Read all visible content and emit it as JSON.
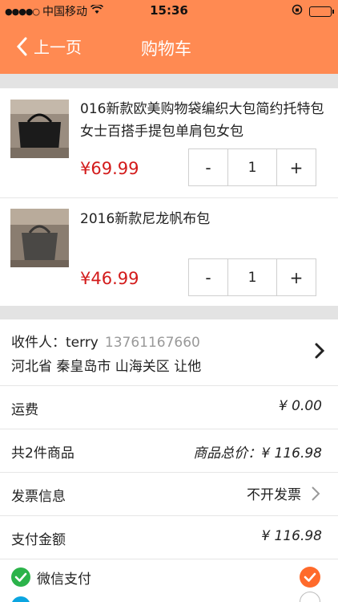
{
  "status": {
    "carrier": "中国移动",
    "time": "15:36"
  },
  "nav": {
    "back_label": "上一页",
    "title": "购物车"
  },
  "items": [
    {
      "title": "016新款欧美购物袋编织大包简约托特包女士百搭手提包单肩包女包",
      "price": "¥69.99",
      "qty": "1"
    },
    {
      "title": "2016新款尼龙帆布包",
      "price": "¥46.99",
      "qty": "1"
    }
  ],
  "stepper": {
    "minus": "-",
    "plus": "+"
  },
  "address": {
    "recipient_label": "收件人：terry",
    "phone": "13761167660",
    "detail": "河北省 秦皇岛市 山海关区 让他"
  },
  "summary": {
    "shipping_label": "运费",
    "shipping_value": "¥ 0.00",
    "count_label": "共2件商品",
    "total_label": "商品总价：¥ 116.98",
    "invoice_label": "发票信息",
    "invoice_value": "不开发票",
    "pay_amount_label": "支付金额",
    "pay_amount_value": "¥ 116.98"
  },
  "payment": {
    "options": [
      {
        "label": "微信支付",
        "selected": true
      }
    ]
  },
  "colors": {
    "brand": "#ff8a52",
    "price": "#d31b1b",
    "check": "#ff6a2b",
    "wechat": "#2bb34a",
    "alipay": "#0ba5e0"
  }
}
